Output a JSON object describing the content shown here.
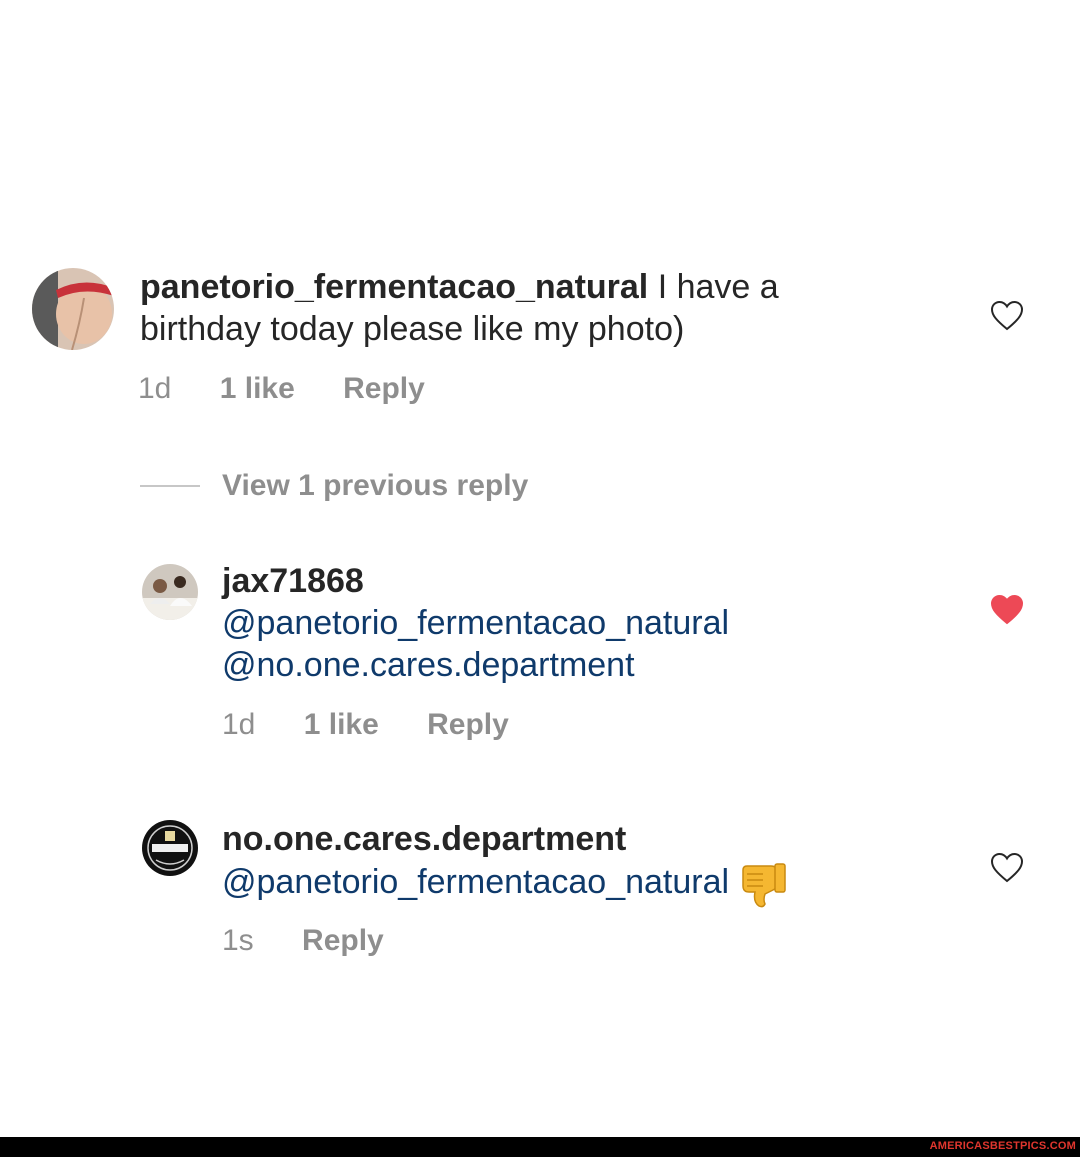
{
  "comments": [
    {
      "username": "panetorio_fermentacao_natural",
      "text": " I have a birthday today please like my photo)",
      "time": "1d",
      "likes": "1 like",
      "reply": "Reply",
      "liked": false
    },
    {
      "username": "jax71868",
      "mentions": [
        "@panetorio_fermentacao_natural",
        "@no.one.cares.department"
      ],
      "time": "1d",
      "likes": "1 like",
      "reply": "Reply",
      "liked": true
    },
    {
      "username": "no.one.cares.department",
      "mentions": [
        "@panetorio_fermentacao_natural"
      ],
      "emoji": "thumbs-down",
      "time": "1s",
      "reply": "Reply",
      "liked": false
    }
  ],
  "view_replies": "View 1 previous reply",
  "watermark": "AMERICASBESTPICS.COM",
  "colors": {
    "text": "#262626",
    "meta": "#8e8e8e",
    "mention": "#0f3a6b",
    "liked_heart": "#ed4956"
  }
}
